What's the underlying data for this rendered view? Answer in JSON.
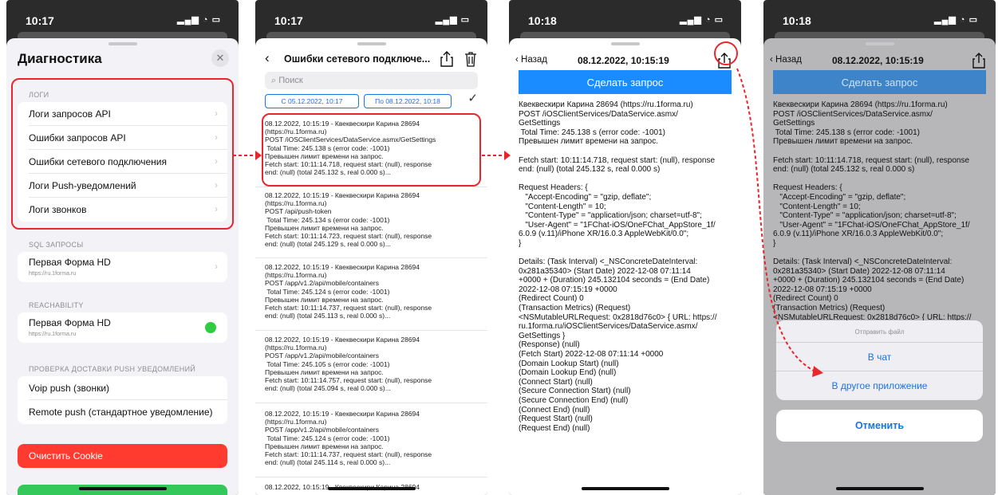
{
  "colors": {
    "accent": "#1a73e8",
    "highlight": "#e8262b",
    "request_button": "#1a8cff",
    "danger": "#ff3b30",
    "success": "#34c759"
  },
  "screen1": {
    "status_time": "10:17",
    "title": "Диагностика",
    "close_icon": "close-icon",
    "logs_section": "ЛОГИ",
    "logs_items": [
      "Логи запросов API",
      "Ошибки запросов API",
      "Ошибки сетевого подключения",
      "Логи Push-уведомлений",
      "Логи звонков"
    ],
    "sql_section": "SQL ЗАПРОСЫ",
    "sql_item": {
      "label": "Первая Форма HD",
      "sub": "https://ru.1forma.ru"
    },
    "reach_section": "REACHABILITY",
    "reach_item": {
      "label": "Первая Форма HD",
      "sub": "https://ru.1forma.ru"
    },
    "push_section": "ПРОВЕРКА ДОСТАВКИ PUSH УВЕДОМЛЕНИЙ",
    "push_items": [
      "Voip push (звонки)",
      "Remote push (стандартное уведомление)"
    ],
    "clear_cookie": "Очистить Cookie"
  },
  "screen2": {
    "status_time": "10:17",
    "title": "Ошибки сетевого подключе...",
    "search_placeholder": "Поиск",
    "date_from": "С 05.12.2022, 10:17",
    "date_to": "По 08.12.2022, 10:18",
    "entries": [
      "08.12.2022, 10:15:19 - Квеквескири Карина 28694\n(https://ru.1forma.ru)\nPOST /iOSClientServices/DataService.asmx/GetSettings\n Total Time: 245.138 s (error code: -1001)\nПревышен лимит времени на запрос.\nFetch start: 10:11:14.718, request start: (null), response\nend: (null) (total 245.132 s, real 0.000 s)...",
      "08.12.2022, 10:15:19 - Квеквескири Карина 28694\n(https://ru.1forma.ru)\nPOST /api/push-token\n Total Time: 245.134 s (error code: -1001)\nПревышен лимит времени на запрос.\nFetch start: 10:11:14.723, request start: (null), response\nend: (null) (total 245.129 s, real 0.000 s)...",
      "08.12.2022, 10:15:19 - Квеквескири Карина 28694\n(https://ru.1forma.ru)\nPOST /app/v1.2/api/mobile/containers\n Total Time: 245.124 s (error code: -1001)\nПревышен лимит времени на запрос.\nFetch start: 10:11:14.737, request start: (null), response\nend: (null) (total 245.113 s, real 0.000 s)...",
      "08.12.2022, 10:15:19 - Квеквескири Карина 28694\n(https://ru.1forma.ru)\nPOST /app/v1.2/api/mobile/containers\n Total Time: 245.105 s (error code: -1001)\nПревышен лимит времени на запрос.\nFetch start: 10:11:14.757, request start: (null), response\nend: (null) (total 245.094 s, real 0.000 s)...",
      "08.12.2022, 10:15:19 - Квеквескири Карина 28694\n(https://ru.1forma.ru)\nPOST /app/v1.2/api/mobile/containers\n Total Time: 245.124 s (error code: -1001)\nПревышен лимит времени на запрос.\nFetch start: 10:11:14.737, request start: (null), response\nend: (null) (total 245.114 s, real 0.000 s)..."
    ],
    "last_entry_head": "08.12.2022, 10:15:19 - Квеквескири Карина 28694"
  },
  "screen3": {
    "status_time": "10:18",
    "back_label": "Назад",
    "title": "08.12.2022, 10:15:19",
    "request_button": "Сделать запрос",
    "detail": "Квеквескири Карина 28694 (https://ru.1forma.ru)\nPOST /iOSClientServices/DataService.asmx/\nGetSettings\n Total Time: 245.138 s (error code: -1001)\nПревышен лимит времени на запрос.\n\nFetch start: 10:11:14.718, request start: (null), response\nend: (null) (total 245.132 s, real 0.000 s)\n\nRequest Headers: {\n   \"Accept-Encoding\" = \"gzip, deflate\";\n   \"Content-Length\" = 10;\n   \"Content-Type\" = \"application/json; charset=utf-8\";\n   \"User-Agent\" = \"1FChat-iOS/OneFChat_AppStore_1f/\n6.0.9 (v.11)/iPhone XR/16.0.3 AppleWebKit/0.0\";\n}\n\nDetails: (Task Interval) <_NSConcreteDateInterval:\n0x281a35340> (Start Date) 2022-12-08 07:11:14\n+0000 + (Duration) 245.132104 seconds = (End Date)\n2022-12-08 07:15:19 +0000\n(Redirect Count) 0\n(Transaction Metrics) (Request)\n<NSMutableURLRequest: 0x2818d76c0> { URL: https://\nru.1forma.ru/iOSClientServices/DataService.asmx/\nGetSettings }\n(Response) (null)\n(Fetch Start) 2022-12-08 07:11:14 +0000\n(Domain Lookup Start) (null)\n(Domain Lookup End) (null)\n(Connect Start) (null)\n(Secure Connection Start) (null)\n(Secure Connection End) (null)\n(Connect End) (null)\n(Request Start) (null)\n(Request End) (null)"
  },
  "screen4": {
    "status_time": "10:18",
    "back_label": "Назад",
    "title": "08.12.2022, 10:15:19",
    "request_button": "Сделать запрос",
    "detail": "Квеквескири Карина 28694 (https://ru.1forma.ru)\nPOST /iOSClientServices/DataService.asmx/\nGetSettings\n Total Time: 245.138 s (error code: -1001)\nПревышен лимит времени на запрос.\n\nFetch start: 10:11:14.718, request start: (null), response\nend: (null) (total 245.132 s, real 0.000 s)\n\nRequest Headers: {\n   \"Accept-Encoding\" = \"gzip, deflate\";\n   \"Content-Length\" = 10;\n   \"Content-Type\" = \"application/json; charset=utf-8\";\n   \"User-Agent\" = \"1FChat-iOS/OneFChat_AppStore_1f/\n6.0.9 (v.11)/iPhone XR/16.0.3 AppleWebKit/0.0\";\n}\n\nDetails: (Task Interval) <_NSConcreteDateInterval:\n0x281a35340> (Start Date) 2022-12-08 07:11:14\n+0000 + (Duration) 245.132104 seconds = (End Date)\n2022-12-08 07:15:19 +0000\n(Redirect Count) 0\n(Transaction Metrics) (Request)\n<NSMutableURLRequest: 0x2818d76c0> { URL: https://",
    "action_title": "Отправить файл",
    "action_chat": "В чат",
    "action_other": "В другое приложение",
    "cancel": "Отменить"
  }
}
